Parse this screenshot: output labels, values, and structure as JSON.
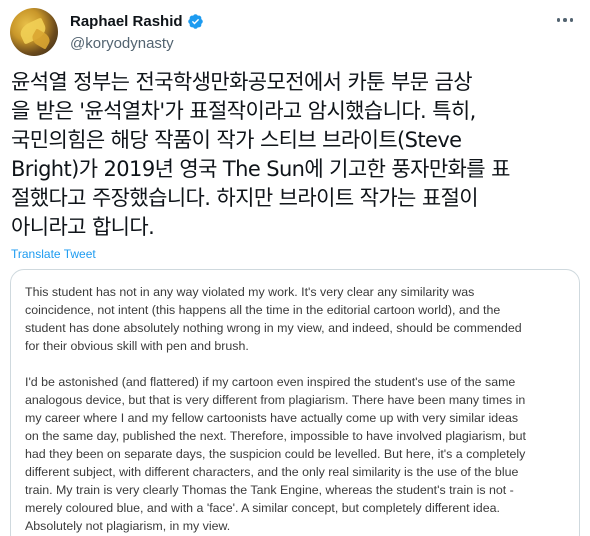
{
  "author": {
    "display_name": "Raphael Rashid",
    "handle": "@koryodynasty",
    "verified": true,
    "avatar_icon": "avatar-photo"
  },
  "tweet": {
    "lines": [
      "윤석열 정부는 전국학생만화공모전에서 카툰 부문 금상",
      "을 받은 '윤석열차'가 표절작이라고 암시했습니다. 특히,",
      "국민의힘은 해당 작품이 작가 스티브 브라이트(Steve",
      "Bright)가 2019년 영국 The Sun에 기고한 풍자만화를 표",
      "절했다고 주장했습니다. 하지만 브라이트 작가는 표절이",
      "아니라고 합니다."
    ],
    "translate_label": "Translate Tweet"
  },
  "quote_card": {
    "paragraph1": [
      "This student has not in any way violated my work. It's very clear any similarity was",
      "coincidence, not intent (this happens all the time in the editorial cartoon world), and the",
      "student has done absolutely nothing wrong in my view, and indeed, should be commended",
      "for their obvious skill with pen and brush."
    ],
    "paragraph2": [
      "I'd be astonished (and flattered) if my cartoon even inspired the student's use of the same",
      "analogous device, but that is very different from plagiarism. There have been many times in",
      "my career where I and my fellow cartoonists have actually come up with very similar ideas",
      "on the same day, published the next. Therefore, impossible to have involved plagiarism, but",
      "had they been on separate days, the suspicion could be levelled.  But here, it's a completely",
      "different subject, with different characters, and the only real similarity is the use of the blue",
      "train. My train is very clearly Thomas the Tank Engine, whereas the student's train is not -",
      "merely coloured blue, and with a 'face'. A similar concept, but completely different idea.",
      "Absolutely not plagiarism, in my view."
    ]
  },
  "colors": {
    "accent": "#1d9bf0",
    "text": "#0f1419",
    "secondary": "#536471",
    "border": "#cfd9de"
  },
  "icons": [
    "avatar-photo",
    "verified-badge-icon",
    "more-options-icon"
  ]
}
